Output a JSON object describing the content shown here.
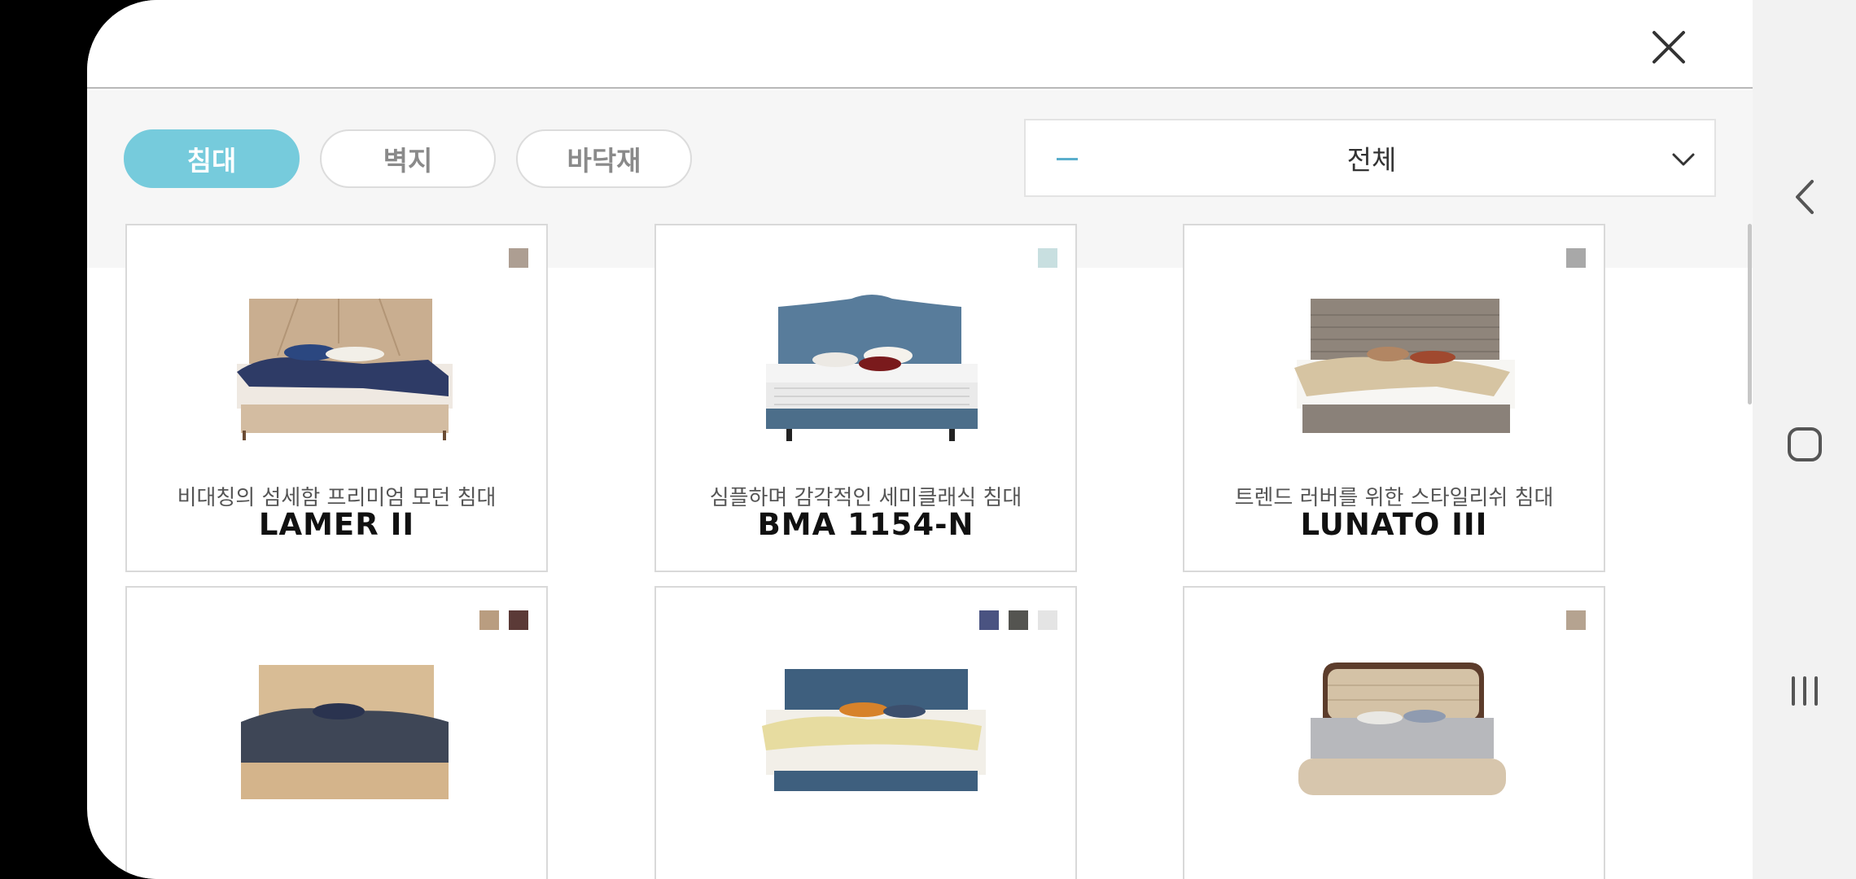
{
  "tabs": [
    {
      "label": "침대",
      "active": true
    },
    {
      "label": "벽지",
      "active": false
    },
    {
      "label": "바닥재",
      "active": false
    }
  ],
  "filter": {
    "value": "전체"
  },
  "products": [
    {
      "subtitle": "비대칭의 섬세함 프리미엄 모던 침대",
      "name": "LAMER II",
      "swatches": [
        "#ad9e92"
      ]
    },
    {
      "subtitle": "심플하며 감각적인 세미클래식 침대",
      "name": "BMA 1154-N",
      "swatches": [
        "#c8dfe0"
      ]
    },
    {
      "subtitle": "트렌드 러버를 위한 스타일리쉬 침대",
      "name": "LUNATO III",
      "swatches": [
        "#a8a8a8"
      ]
    },
    {
      "subtitle": "",
      "name": "",
      "swatches": [
        "#b99d80",
        "#5b3a37"
      ]
    },
    {
      "subtitle": "",
      "name": "",
      "swatches": [
        "#4a5381",
        "#545450",
        "#e4e4e4"
      ]
    },
    {
      "subtitle": "",
      "name": "",
      "swatches": [
        "#b5a390"
      ]
    }
  ],
  "colors": {
    "accent": "#76cbdc",
    "panel": "#f6f6f6"
  }
}
